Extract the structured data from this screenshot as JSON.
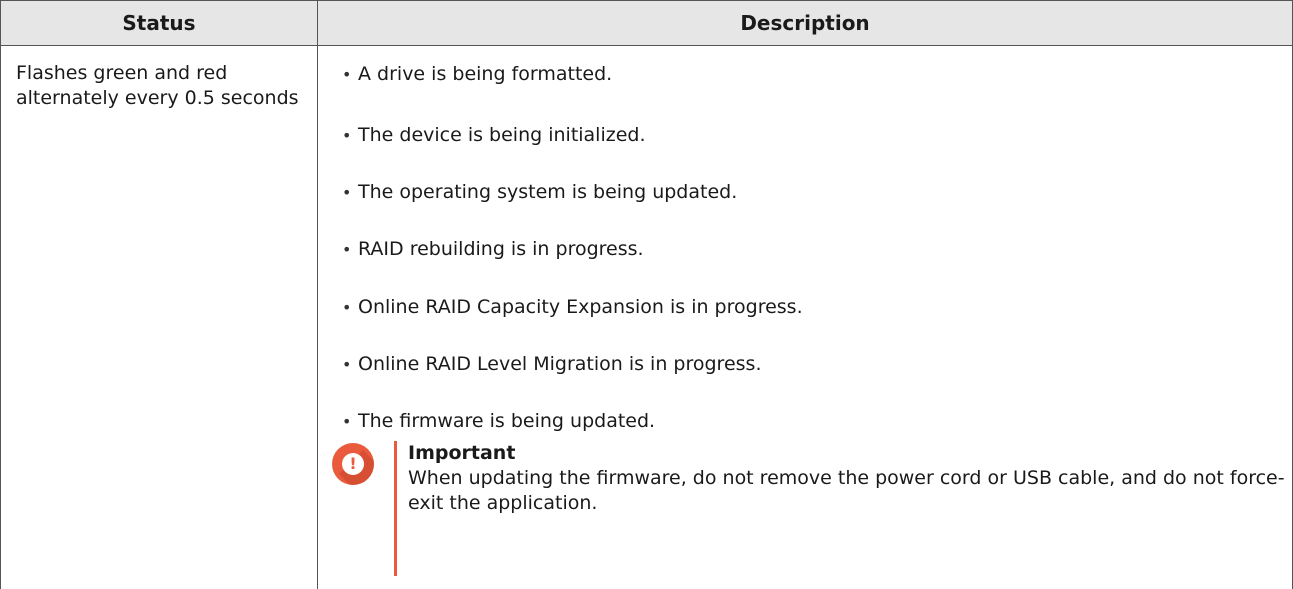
{
  "table": {
    "headers": {
      "status": "Status",
      "description": "Description"
    },
    "rows": [
      {
        "status": "Flashes green and red alternately every 0.5 seconds",
        "bullets": [
          "A drive is being formatted.",
          "The device is being initialized.",
          "The operating system is being updated.",
          "RAID rebuilding is in progress.",
          "Online RAID Capacity Expansion is in progress.",
          "Online RAID Level Migration is in progress.",
          "The firmware is being updated."
        ],
        "note": {
          "icon": "exclamation-icon",
          "title": "Important",
          "body": "When updating the firmware, do not remove the power cord or USB cable, and do not force-exit the application."
        }
      }
    ]
  },
  "colors": {
    "header_bg": "#e6e6e6",
    "border": "#555555",
    "important_accent": "#e95b3c"
  }
}
